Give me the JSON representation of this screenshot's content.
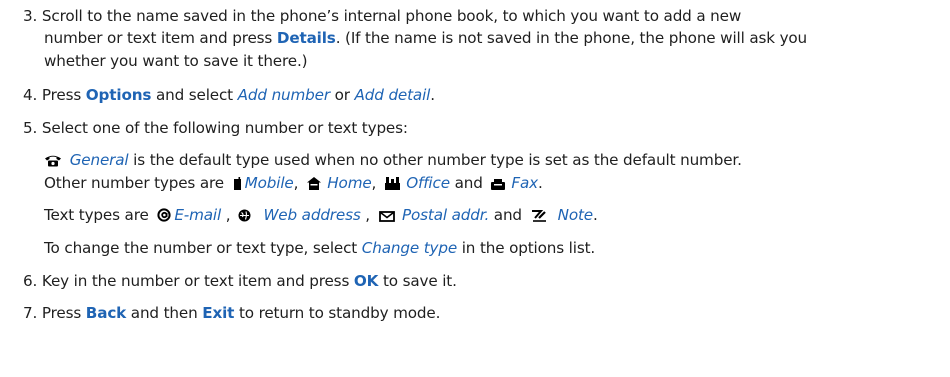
{
  "steps": {
    "s3": {
      "num": "3.",
      "a": "Scroll to the name saved in the phone’s internal phone book, to which you want to add a new",
      "b": "number or text item and press ",
      "details": "Details",
      "c": ". (If the name is not saved in the phone, the phone will ask you",
      "d": "whether you want to save it there.)"
    },
    "s4": {
      "num": "4.",
      "press": "Press ",
      "options": "Options",
      "mid": " and select ",
      "add_number": "Add number",
      "or": " or ",
      "add_detail": "Add detail",
      "end": "."
    },
    "s5": {
      "num": "5.",
      "text": "Select one of the following number or text types:",
      "general": "General",
      "general_desc": " is the default type used when no other number type is set as the default number.",
      "other_prefix": "Other number types are ",
      "mobile": "Mobile",
      "comma1": ",",
      "home": "Home",
      "comma2": ",",
      "office": "Office",
      "and1": " and ",
      "fax": "Fax",
      "dot1": ".",
      "text_prefix": "Text types are ",
      "email": "E-mail",
      "comma3": " ,",
      "web": "Web address",
      "comma4": " ,",
      "postal": "Postal addr.",
      "and2": " and ",
      "note": "Note",
      "dot2": ".",
      "change_prefix": "To change the number or text type, select ",
      "change_type": "Change type",
      "change_suffix": " in the options list."
    },
    "s6": {
      "num": "6.",
      "a": "Key in the number or text item and press ",
      "ok": "OK",
      "b": " to save it."
    },
    "s7": {
      "num": "7.",
      "press": "Press ",
      "back": "Back",
      "mid": " and then ",
      "exit": "Exit",
      "end": " to return to standby mode."
    }
  },
  "icons": [
    "general-phone-icon",
    "mobile-icon",
    "home-icon",
    "office-icon",
    "fax-icon",
    "email-icon",
    "web-address-icon",
    "postal-address-icon",
    "note-icon"
  ],
  "colors": {
    "text": "#1f1f1f",
    "highlight": "#1f64b4"
  }
}
